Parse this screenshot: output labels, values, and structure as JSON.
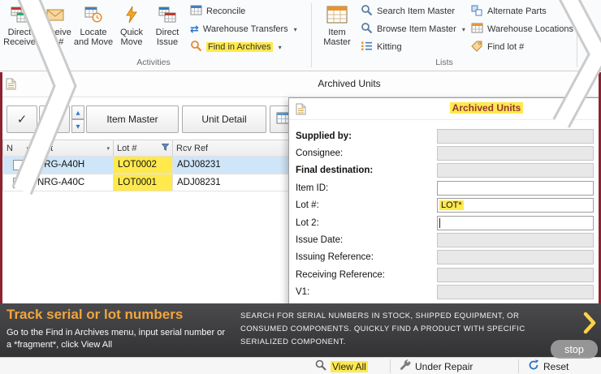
{
  "colors": {
    "highlight_yellow": "#ffe94d",
    "selected_row_blue": "#cfe6f8",
    "accent_orange": "#e8952f",
    "headline_orange": "#f2a53c",
    "banner_background": "#3c3c3e",
    "maroon_edge": "#8c2332",
    "icon_blue": "#2e75c8"
  },
  "glyphs": {
    "caret": "▾",
    "up": "▲",
    "down": "▼",
    "check": "✓",
    "transfer": "⇄"
  },
  "ribbon": {
    "group_labels": [
      "Activities",
      "Lists"
    ],
    "big": [
      {
        "label": "Direct Receive",
        "icon": "tables-receive-icon"
      },
      {
        "label": "Receive lot #",
        "icon": "envelope-icon"
      },
      {
        "label": "Locate and Move",
        "icon": "clock-table-icon"
      },
      {
        "label": "Quick Move",
        "icon": "lightning-icon"
      },
      {
        "label": "Direct Issue",
        "icon": "tables-issue-icon"
      },
      {
        "label": "Item Master",
        "icon": "table-orange-icon"
      }
    ],
    "small": [
      {
        "label": "Reconcile",
        "dropdown": false,
        "highlighted": false
      },
      {
        "label": "Warehouse Transfers",
        "dropdown": true,
        "highlighted": false
      },
      {
        "label": "Find in Archives",
        "dropdown": true,
        "highlighted": true
      },
      {
        "label": "Search Item Master",
        "dropdown": false,
        "highlighted": false
      },
      {
        "label": "Browse Item Master",
        "dropdown": true,
        "highlighted": false
      },
      {
        "label": "Kitting",
        "dropdown": false,
        "highlighted": false
      },
      {
        "label": "Alternate Parts",
        "dropdown": false,
        "highlighted": false
      },
      {
        "label": "Warehouse Locations",
        "dropdown": true,
        "highlighted": false
      },
      {
        "label": "Find lot #",
        "dropdown": false,
        "highlighted": false
      }
    ]
  },
  "window": {
    "title": "Archived Units"
  },
  "toolbar": {
    "item_master": "Item Master",
    "unit_detail": "Unit Detail"
  },
  "table": {
    "columns": [
      {
        "label": "N"
      },
      {
        "label": "Part"
      },
      {
        "label": "Lot #"
      },
      {
        "label": "Rcv Ref"
      }
    ],
    "rows": [
      {
        "part": "NRG-A40H",
        "lot": "LOT0002",
        "rcv": "ADJ08231",
        "selected": true,
        "checked": false
      },
      {
        "part": "NRG-A40C",
        "lot": "LOT0001",
        "rcv": "ADJ08231",
        "selected": false,
        "checked": false
      }
    ]
  },
  "dialog": {
    "title": "Archived Units",
    "fields": [
      {
        "label": "Supplied by:",
        "value": "",
        "readonly": true
      },
      {
        "label": "Consignee:",
        "value": "",
        "readonly": true
      },
      {
        "label": "Final destination:",
        "value": "",
        "readonly": true
      },
      {
        "label": "Item ID:",
        "value": "",
        "readonly": false
      },
      {
        "label": "Lot #:",
        "value": "LOT*",
        "readonly": false,
        "highlighted": true
      },
      {
        "label": "Lot 2:",
        "value": "",
        "readonly": false,
        "focused": true
      },
      {
        "label": "Issue Date:",
        "value": "",
        "readonly": true
      },
      {
        "label": "Issuing Reference:",
        "value": "",
        "readonly": true
      },
      {
        "label": "Receiving Reference:",
        "value": "",
        "readonly": true
      },
      {
        "label": "V1:",
        "value": "",
        "readonly": true
      }
    ],
    "buttons": [
      {
        "label": "View All",
        "highlighted": true
      },
      {
        "label": "Under Repair",
        "highlighted": false
      },
      {
        "label": "Reset",
        "highlighted": false
      }
    ]
  },
  "banner": {
    "headline": "Track serial or lot numbers",
    "subtext": "Go to the Find in Archives menu, input serial number or a *fragment*, click View All",
    "caption": "SEARCH FOR SERIAL NUMBERS IN STOCK, SHIPPED EQUIPMENT, OR CONSUMED COMPONENTS. QUICKLY FIND A PRODUCT WITH SPECIFIC SERIALIZED COMPONENT.",
    "stop_label": "stop"
  }
}
